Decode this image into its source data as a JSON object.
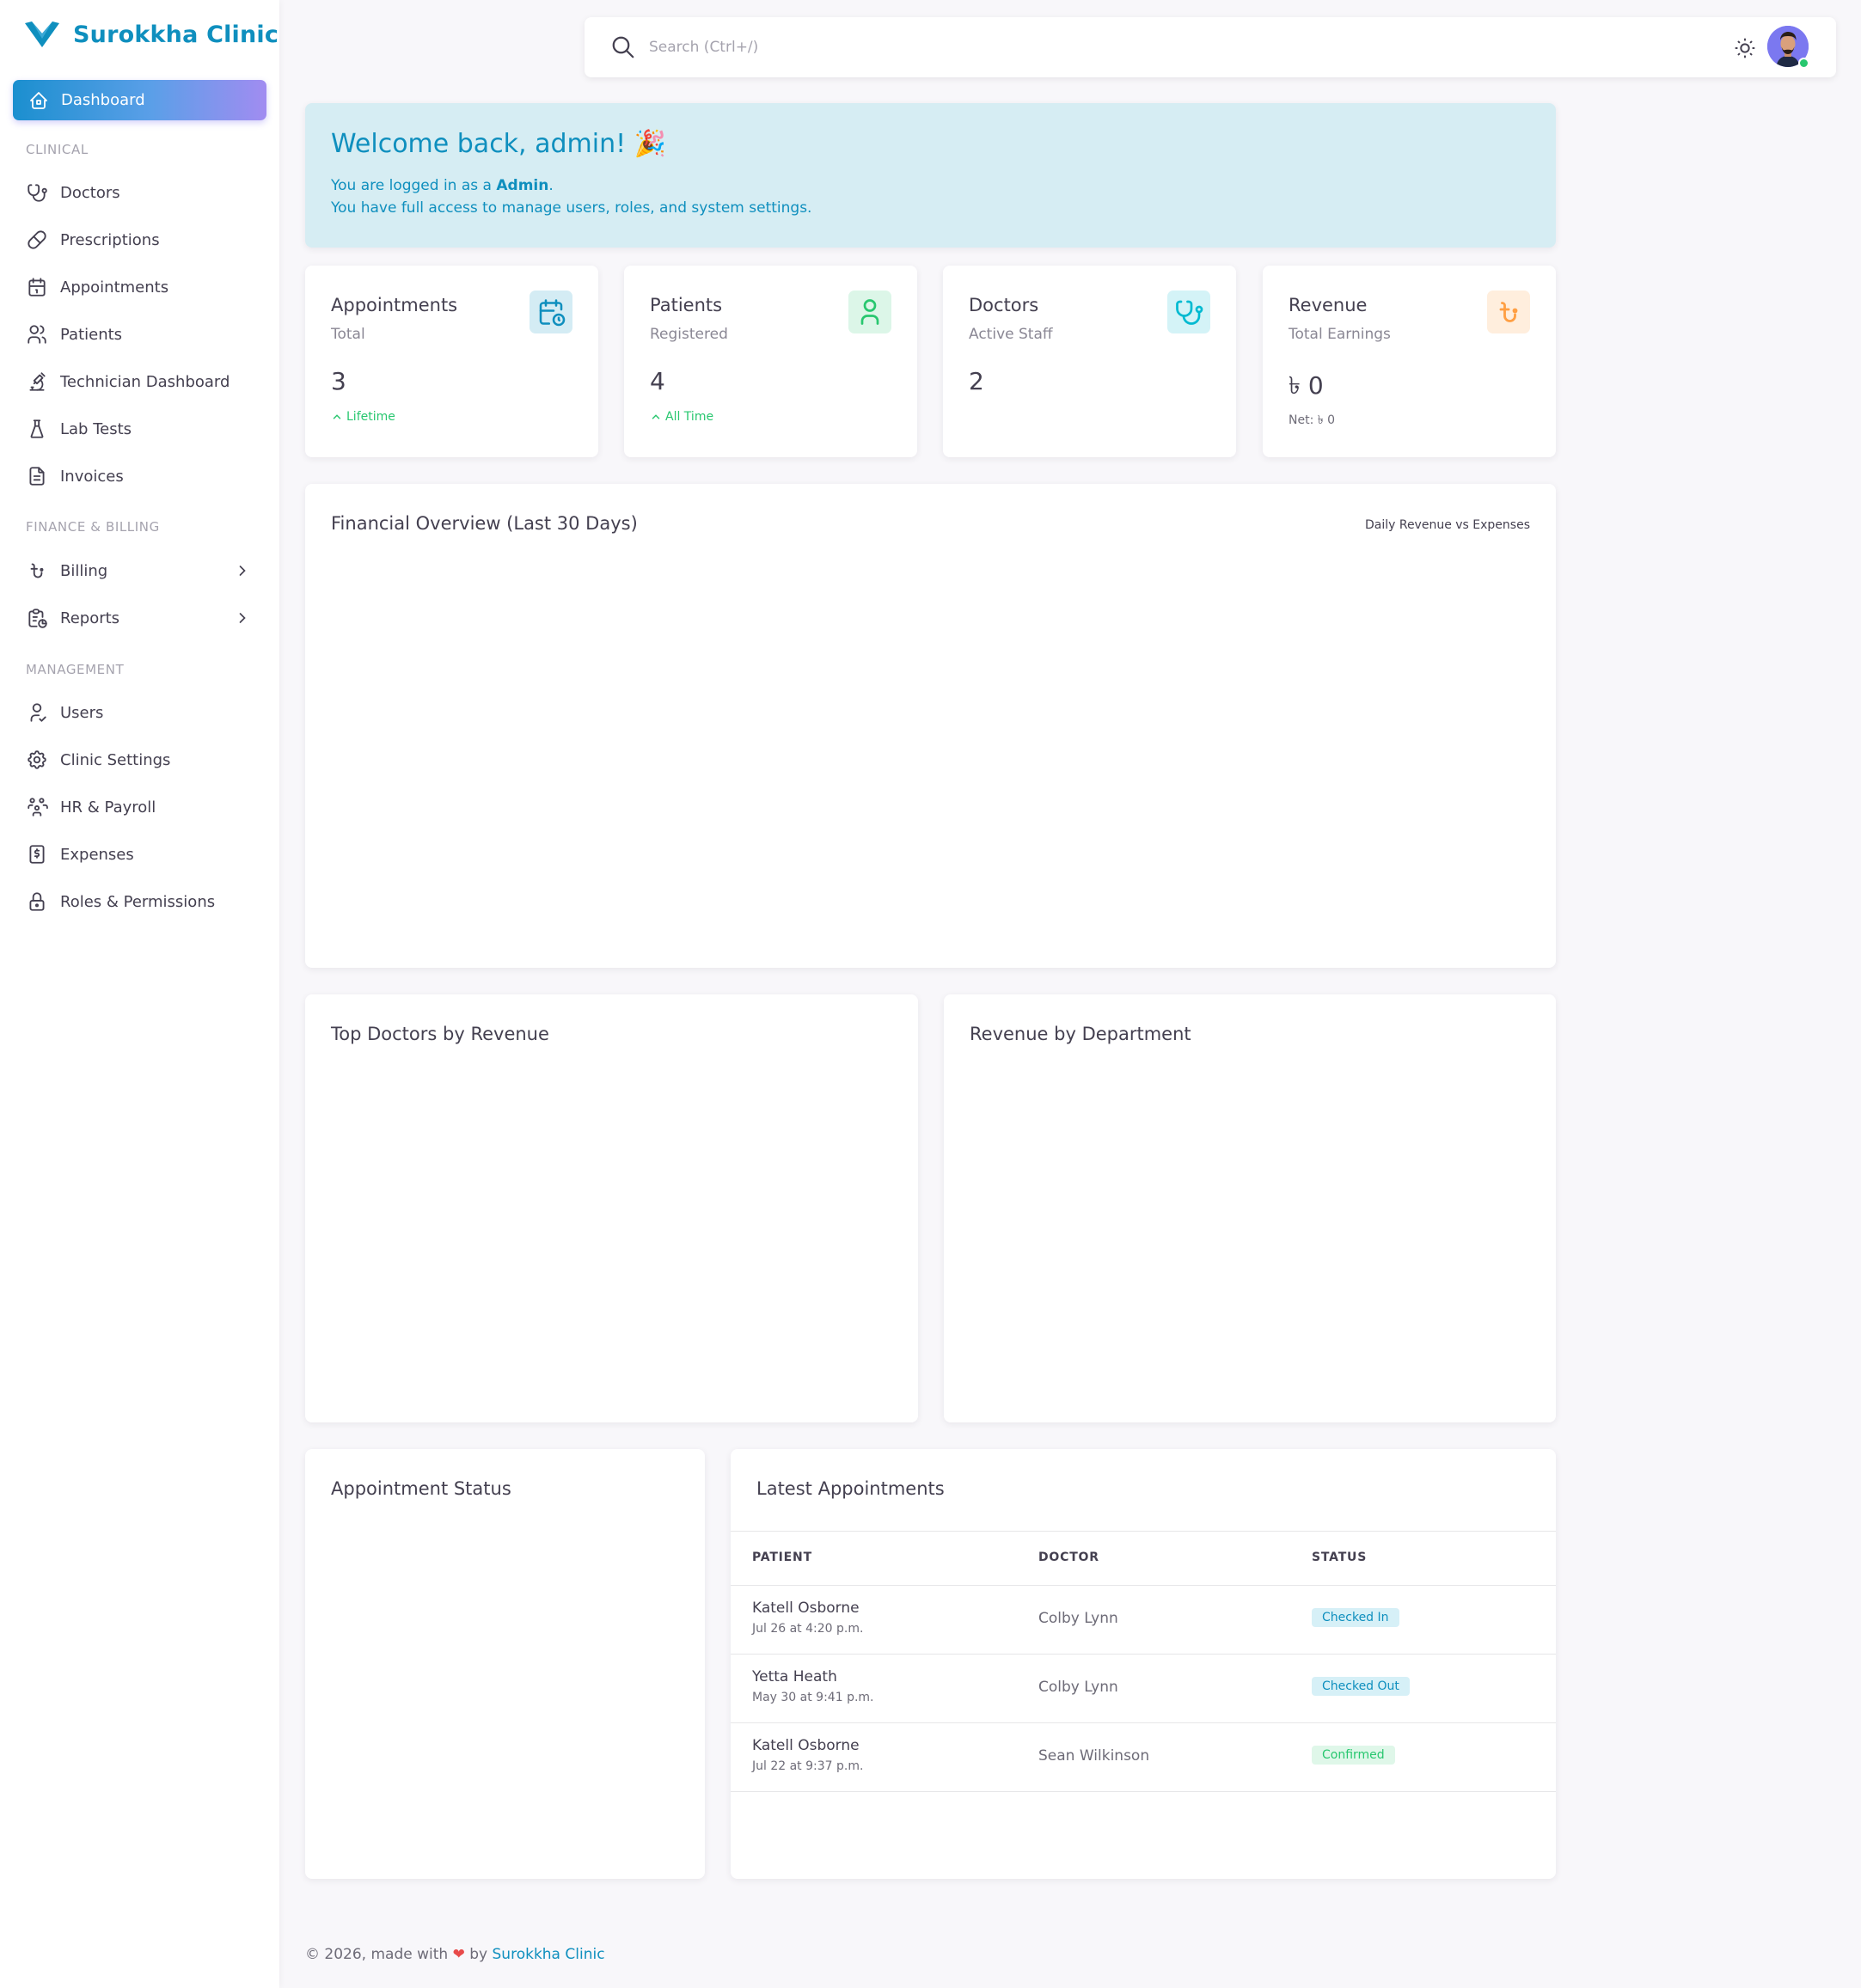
{
  "brand": {
    "name": "Surokkha Clinic",
    "accent": "#0f8fbe"
  },
  "search": {
    "placeholder": "Search (Ctrl+/)"
  },
  "sidebar": {
    "active": "Dashboard",
    "sections": {
      "clinical": "CLINICAL",
      "finance": "FINANCE & BILLING",
      "management": "MANAGEMENT"
    },
    "items": {
      "doctors": "Doctors",
      "prescriptions": "Prescriptions",
      "appointments": "Appointments",
      "patients": "Patients",
      "technician": "Technician Dashboard",
      "lab_tests": "Lab Tests",
      "invoices": "Invoices",
      "billing": "Billing",
      "reports": "Reports",
      "users": "Users",
      "clinic_settings": "Clinic Settings",
      "hr_payroll": "HR & Payroll",
      "expenses": "Expenses",
      "roles": "Roles & Permissions"
    }
  },
  "welcome": {
    "title": "Welcome back, admin! 🎉",
    "line1_prefix": "You are logged in as a ",
    "line1_role": "Admin",
    "line1_suffix": ".",
    "line2": "You have full access to manage users, roles, and system settings."
  },
  "stats": {
    "appointments": {
      "title": "Appointments",
      "sub": "Total",
      "value": "3",
      "note": "Lifetime",
      "color": "#0f8fbe"
    },
    "patients": {
      "title": "Patients",
      "sub": "Registered",
      "value": "4",
      "note": "All Time",
      "color": "#28c76f"
    },
    "doctors": {
      "title": "Doctors",
      "sub": "Active Staff",
      "value": "2",
      "color": "#00bad1"
    },
    "revenue": {
      "title": "Revenue",
      "sub": "Total Earnings",
      "value": "৳ 0",
      "note": "Net: ৳ 0",
      "color": "#ff9f43"
    }
  },
  "panels": {
    "financial": {
      "title": "Financial Overview (Last 30 Days)",
      "sub": "Daily Revenue vs Expenses"
    },
    "top_doctors": {
      "title": "Top Doctors by Revenue"
    },
    "revenue_dept": {
      "title": "Revenue by Department"
    },
    "appt_status": {
      "title": "Appointment Status"
    },
    "latest": {
      "title": "Latest Appointments",
      "columns": [
        "PATIENT",
        "DOCTOR",
        "STATUS"
      ],
      "rows": [
        {
          "patient": "Katell Osborne",
          "date": "Jul 26 at 4:20 p.m.",
          "doctor": "Colby Lynn",
          "status": "Checked In"
        },
        {
          "patient": "Yetta Heath",
          "date": "May 30 at 9:41 p.m.",
          "doctor": "Colby Lynn",
          "status": "Checked Out"
        },
        {
          "patient": "Katell Osborne",
          "date": "Jul 22 at 9:37 p.m.",
          "doctor": "Sean Wilkinson",
          "status": "Confirmed"
        }
      ]
    }
  },
  "footer": {
    "prefix": "© 2026, made with",
    "by": "by",
    "brand": "Surokkha Clinic"
  }
}
